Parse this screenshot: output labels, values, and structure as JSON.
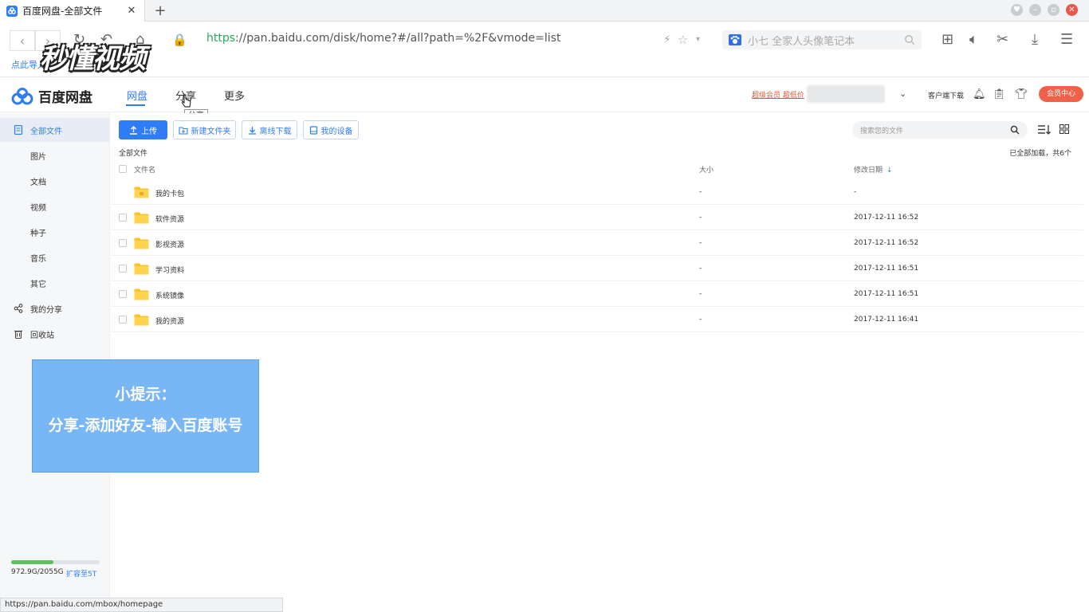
{
  "browser": {
    "tab_title": "百度网盘-全部文件",
    "new_tab_label": "+",
    "url_scheme": "https",
    "url_rest": "://pan.baidu.com/disk/home?#/all?path=%2F&vmode=list",
    "search_placeholder": "小七 全家人头像笔记本",
    "bookmark_text": "点此导入",
    "status_url": "https://pan.baidu.com/mbox/homepage"
  },
  "watermark": "秒懂视频",
  "app": {
    "logo_text": "百度网盘",
    "nav": [
      {
        "label": "网盘",
        "active": true
      },
      {
        "label": "分享",
        "active": false
      },
      {
        "label": "更多",
        "active": false
      }
    ],
    "tooltip": "分享",
    "promo": "超级会员 超低价",
    "client_download": "客户端下载",
    "vip_button": "会员中心",
    "accent": "#2f7df6"
  },
  "sidebar": {
    "items": [
      {
        "label": "全部文件",
        "icon": "file-icon",
        "active": true
      },
      {
        "label": "图片"
      },
      {
        "label": "文档"
      },
      {
        "label": "视频"
      },
      {
        "label": "种子"
      },
      {
        "label": "音乐"
      },
      {
        "label": "其它"
      },
      {
        "label": "我的分享",
        "icon": "share-icon"
      },
      {
        "label": "回收站",
        "icon": "trash-icon"
      }
    ],
    "quota_text": "972.9G/2055G",
    "quota_fraction": 0.473,
    "expand_link": "扩容至5T"
  },
  "toolbar": {
    "upload": "上传",
    "new_folder": "新建文件夹",
    "offline_download": "离线下载",
    "my_devices": "我的设备",
    "search_placeholder": "搜索您的文件"
  },
  "list": {
    "breadcrumb": "全部文件",
    "loaded_text": "已全部加载，共6个",
    "col_name": "文件名",
    "col_size": "大小",
    "col_date": "修改日期",
    "rows": [
      {
        "name": "我的卡包",
        "size": "-",
        "date": "-"
      },
      {
        "name": "软件资源",
        "size": "-",
        "date": "2017-12-11 16:52"
      },
      {
        "name": "影视资源",
        "size": "-",
        "date": "2017-12-11 16:52"
      },
      {
        "name": "学习资料",
        "size": "-",
        "date": "2017-12-11 16:51"
      },
      {
        "name": "系统镜像",
        "size": "-",
        "date": "2017-12-11 16:51"
      },
      {
        "name": "我的资源",
        "size": "-",
        "date": "2017-12-11 16:41"
      }
    ]
  },
  "tip": {
    "line1": "小提示：",
    "line2": "分享-添加好友-输入百度账号"
  }
}
